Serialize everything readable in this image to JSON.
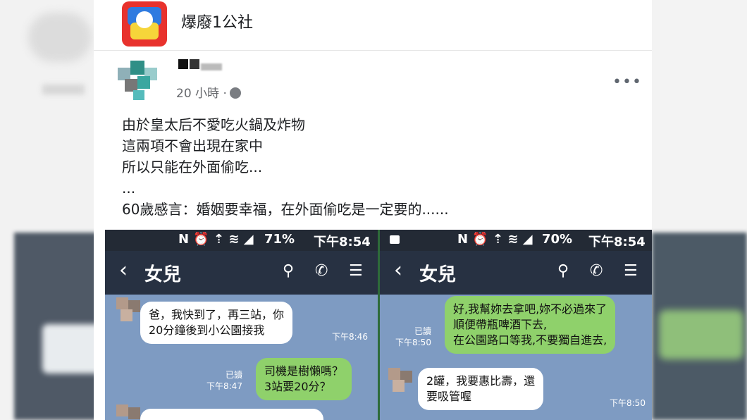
{
  "page": {
    "name": "爆廢1公社"
  },
  "post": {
    "time": "20 小時 ·",
    "more_label": "•••",
    "lines": [
      "由於皇太后不愛吃火鍋及炸物",
      "這兩項不會出現在家中",
      "所以只能在外面偷吃...",
      "...",
      "60歲感言：婚姻要幸福，在外面偷吃是一定要的......"
    ]
  },
  "left_phone": {
    "status_icons": "N ⏰ ⇡ ≋ ◢",
    "battery": "71%",
    "time": "下午8:54",
    "back": "‹",
    "title": "女兒",
    "messages": {
      "m1_line1": "爸，我快到了，再三站，你",
      "m1_line2": "20分鐘後到小公園接我",
      "m1_time": "下午8:46",
      "m2_line1": "司機是樹懶嗎？",
      "m2_line2": "3站要20分？",
      "m2_read": "已讀",
      "m2_time": "下午8:47"
    }
  },
  "right_phone": {
    "status_icons": "N ⏰ ⇡ ≋ ◢",
    "battery": "70%",
    "time": "下午8:54",
    "back": "‹",
    "title": "女兒",
    "messages": {
      "m1_line1": "好,我幫妳去拿吧,妳不必過來了",
      "m1_line2": "順便帶瓶啤酒下去,",
      "m1_line3": "在公園路口等我,不要獨自進去,",
      "m1_read": "已讀",
      "m1_time": "下午8:50",
      "m2_line1": "2罐，我要惠比壽，還",
      "m2_line2": "要吸管喔",
      "m2_time": "下午8:50"
    }
  },
  "icons": {
    "search": "search-icon",
    "phone": "phone-icon",
    "menu": "menu-icon",
    "globe": "globe-icon",
    "more": "more-icon"
  },
  "colors": {
    "chat_bg": "#7e9bc2",
    "nav_bg": "#273142",
    "green_bubble": "#8fd16b"
  }
}
